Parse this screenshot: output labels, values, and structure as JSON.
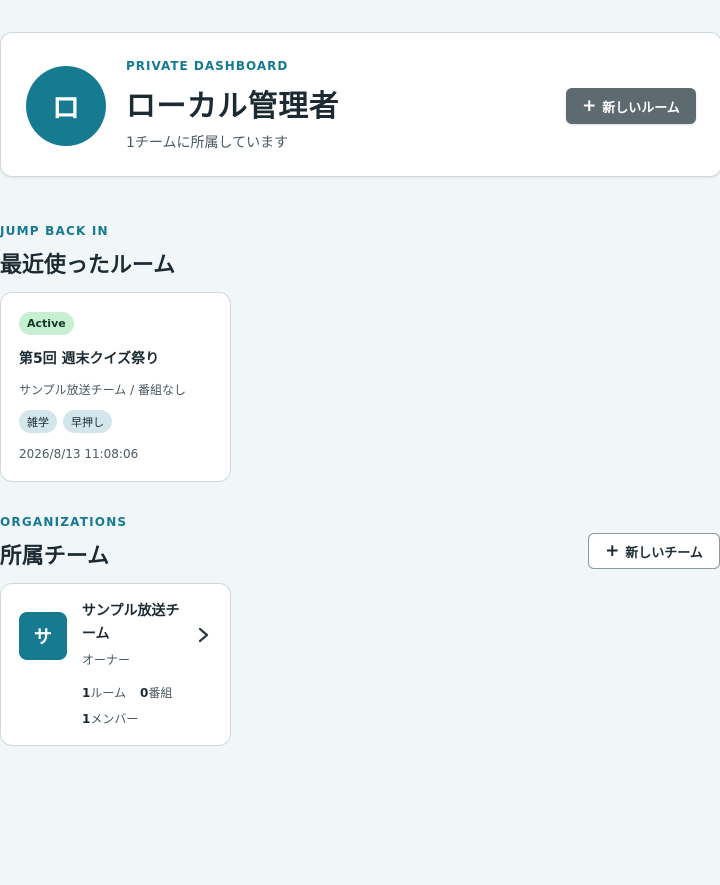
{
  "profile": {
    "avatar_letter": "ロ",
    "eyebrow": "PRIVATE DASHBOARD",
    "name": "ローカル管理者",
    "subtitle": "1チームに所属しています",
    "new_room_label": "新しいルーム"
  },
  "recent": {
    "eyebrow": "JUMP BACK IN",
    "title": "最近使ったルーム",
    "rooms": [
      {
        "status": "Active",
        "title": "第5回 週末クイズ祭り",
        "meta": "サンプル放送チーム / 番組なし",
        "tags": [
          "雑学",
          "早押し"
        ],
        "timestamp": "2026/8/13 11:08:06"
      }
    ]
  },
  "organizations": {
    "eyebrow": "ORGANIZATIONS",
    "title": "所属チーム",
    "new_team_label": "新しいチーム",
    "teams": [
      {
        "avatar_letter": "サ",
        "name": "サンプル放送チーム",
        "role": "オーナー",
        "rooms_count": "1",
        "rooms_unit": "ルーム",
        "programs_count": "0",
        "programs_unit": "番組",
        "members_count": "1",
        "members_unit": "メンバー"
      }
    ]
  },
  "colors": {
    "accent": "#167a91",
    "active_badge": "#c7efd2",
    "tag": "#d3e6ec",
    "primary_button": "#5d6a70"
  }
}
